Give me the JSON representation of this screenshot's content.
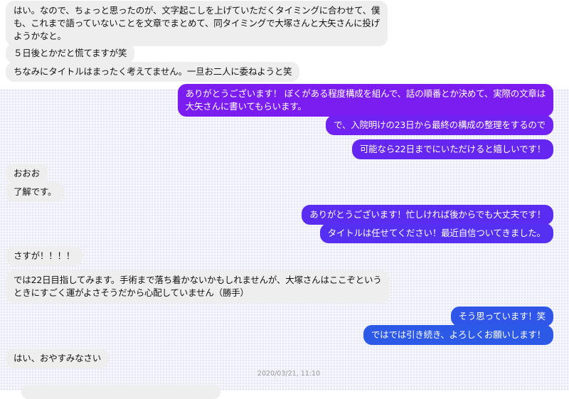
{
  "conversation": {
    "timestamp": "2020/03/21, 11:10",
    "colors": {
      "incoming_bg": "#eeeeef",
      "outgoing_purple": "#7b1cf0",
      "outgoing_violet": "#5a2cf2",
      "outgoing_blue": "#2c5ae6"
    },
    "messages": [
      {
        "from": "them",
        "lines": [
          "はい。なので、ちょっと思ったのが、文字起こしを上げていただくタイミングに合わせて、僕",
          "も、これまで語っていないことを文章でまとめて、同タイミングで大塚さんと大矢さんに投げ",
          "ようかなと。"
        ]
      },
      {
        "from": "them",
        "lines": [
          "５日後とかだと慌てますが笑"
        ]
      },
      {
        "from": "them",
        "lines": [
          "ちなみにタイトルはまったく考えてません。一旦お二人に委ねようと笑"
        ]
      },
      {
        "from": "me",
        "lines": [
          "ありがとうございます！ ぼくがある程度構成を組んで、話の順番とか決めて、実際の文章は",
          "大矢さんに書いてもらいます。"
        ]
      },
      {
        "from": "me",
        "lines": [
          "で、入院明けの23日から最終の構成の整理をするので"
        ]
      },
      {
        "from": "me",
        "lines": [
          "可能なら22日までにいただけると嬉しいです！"
        ]
      },
      {
        "from": "them",
        "lines": [
          "おおお"
        ]
      },
      {
        "from": "them",
        "lines": [
          "了解です。"
        ]
      },
      {
        "from": "me",
        "lines": [
          "ありがとうございます！忙しければ後からでも大丈夫です！"
        ]
      },
      {
        "from": "me",
        "lines": [
          "タイトルは任せてください！最近自信ついてきました。"
        ]
      },
      {
        "from": "them",
        "lines": [
          "さすが！！！！"
        ]
      },
      {
        "from": "them",
        "lines": [
          "では22日目指してみます。手術まで落ち着かないかもしれませんが、大塚さんはここぞという",
          "ときにすごく運がよさそうだから心配していません（勝手）"
        ]
      },
      {
        "from": "me",
        "lines": [
          "そう思っています！笑"
        ]
      },
      {
        "from": "me",
        "lines": [
          "ではでは引き続き、よろしくお願いします！"
        ]
      },
      {
        "from": "them",
        "lines": [
          "はい、おやすみなさい"
        ]
      }
    ]
  }
}
